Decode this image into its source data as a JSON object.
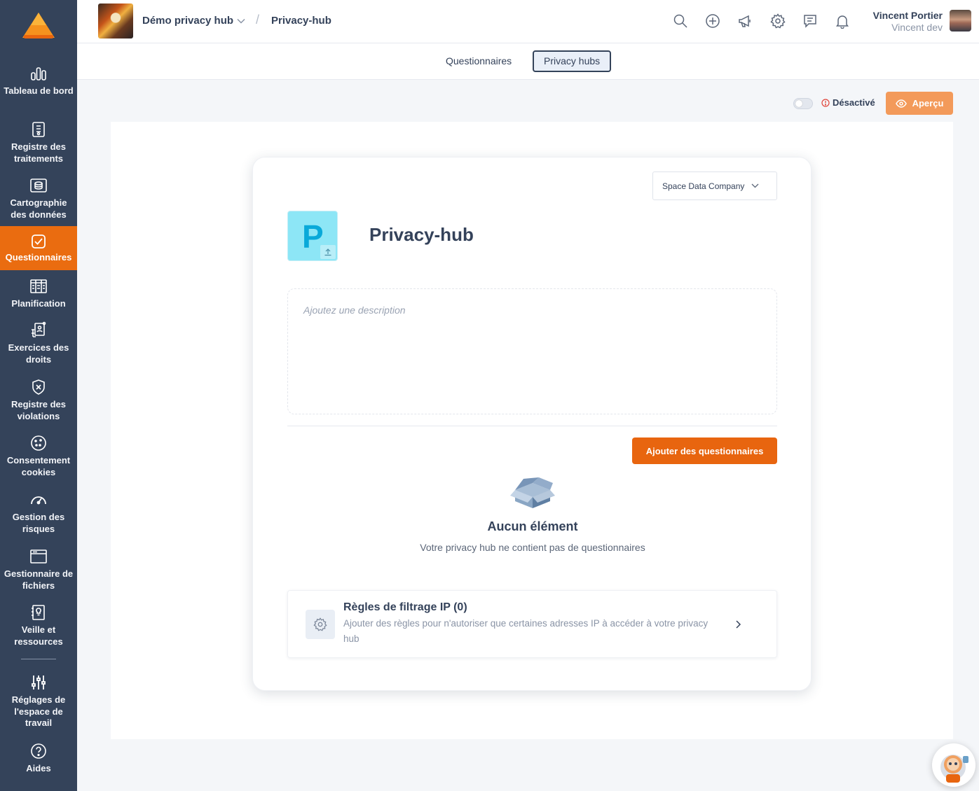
{
  "sidebar": {
    "items": [
      {
        "label": "Tableau de bord",
        "icon": "dashboard-icon"
      },
      {
        "label": "Registre des traitements",
        "icon": "register-icon"
      },
      {
        "label": "Cartographie des données",
        "icon": "data-map-icon"
      },
      {
        "label": "Questionnaires",
        "icon": "questionnaire-icon",
        "active": true
      },
      {
        "label": "Planification",
        "icon": "calendar-icon"
      },
      {
        "label": "Exercices des droits",
        "icon": "rights-icon"
      },
      {
        "label": "Registre des violations",
        "icon": "shield-x-icon"
      },
      {
        "label": "Consentement cookies",
        "icon": "cookie-icon"
      },
      {
        "label": "Gestion des risques",
        "icon": "gauge-icon"
      },
      {
        "label": "Gestionnaire de fichiers",
        "icon": "folder-icon"
      },
      {
        "label": "Veille et ressources",
        "icon": "bulb-book-icon"
      },
      {
        "label": "Réglages de l'espace de travail",
        "icon": "sliders-icon"
      },
      {
        "label": "Aides",
        "icon": "help-icon"
      }
    ]
  },
  "header": {
    "workspace_name": "Démo privacy hub",
    "breadcrumb_separator": "/",
    "breadcrumb_current": "Privacy-hub",
    "user_name": "Vincent Portier",
    "user_workspace": "Vincent dev"
  },
  "tabs": [
    {
      "label": "Questionnaires",
      "active": false
    },
    {
      "label": "Privacy hubs",
      "active": true
    }
  ],
  "actions": {
    "status_label": "Désactivé",
    "preview_label": "Aperçu"
  },
  "hub": {
    "company": "Space Data Company",
    "logo_letter": "P",
    "title": "Privacy-hub",
    "description_placeholder": "Ajoutez une description",
    "add_button": "Ajouter des questionnaires",
    "empty_title": "Aucun élément",
    "empty_subtitle": "Votre privacy hub ne contient pas de questionnaires",
    "ip_title": "Règles de filtrage IP (0)",
    "ip_description": "Ajouter des règles pour n'autoriser que certaines adresses IP à accéder à votre privacy hub"
  },
  "colors": {
    "sidebar_bg": "#34435a",
    "accent": "#e8650f",
    "preview_btn": "#f39a5a",
    "hub_logo_bg": "#8de6f6"
  }
}
